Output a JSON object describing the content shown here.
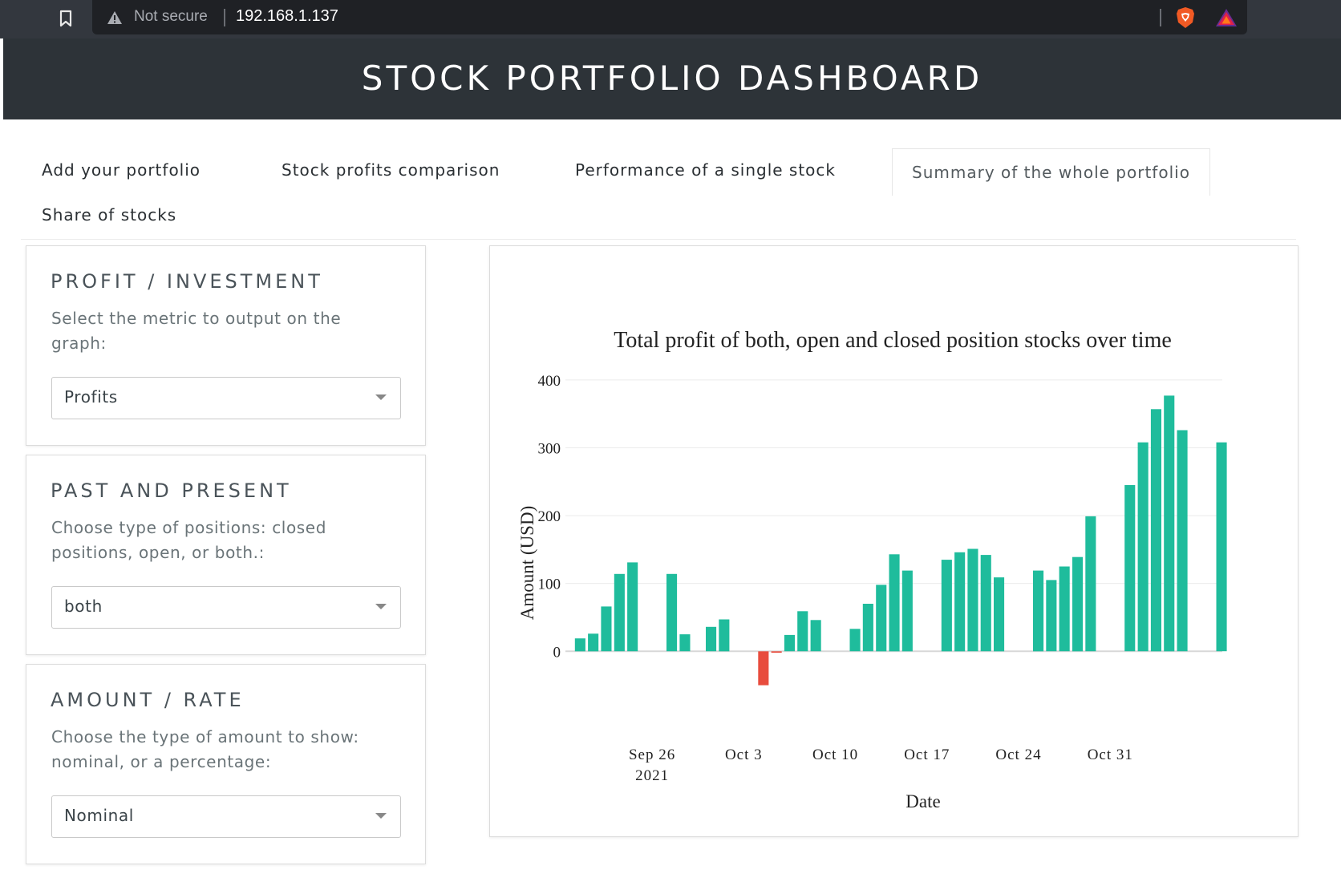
{
  "browser": {
    "security_label": "Not secure",
    "url": "192.168.1.137"
  },
  "header": {
    "title": "STOCK PORTFOLIO DASHBOARD"
  },
  "tabs": [
    {
      "label": "Add your portfolio",
      "active": false
    },
    {
      "label": "Stock profits comparison",
      "active": false
    },
    {
      "label": "Performance of a single stock",
      "active": false
    },
    {
      "label": "Summary of the whole portfolio",
      "active": true
    },
    {
      "label": "Share of stocks",
      "active": false
    }
  ],
  "controls": [
    {
      "title": "PROFIT / INVESTMENT",
      "description": "Select the metric to output on the graph:",
      "selected": "Profits"
    },
    {
      "title": "PAST AND PRESENT",
      "description": "Choose type of positions: closed positions, open, or both.:",
      "selected": "both"
    },
    {
      "title": "AMOUNT / RATE",
      "description": "Choose the type of amount to show: nominal, or a percentage:",
      "selected": "Nominal"
    }
  ],
  "colors": {
    "positive": "#1fbc9c",
    "negative": "#e84c3d",
    "header_bg": "#2d3338"
  },
  "chart_data": {
    "type": "bar",
    "title": "Total profit of both, open and closed position stocks over time",
    "xlabel": "Date",
    "ylabel": "Amount (USD)",
    "ylim": [
      -60,
      420
    ],
    "yticks": [
      0,
      100,
      200,
      300,
      400
    ],
    "x_tick_labels": [
      {
        "date": "2021-09-26",
        "label": "Sep 26",
        "sublabel": "2021"
      },
      {
        "date": "2021-10-03",
        "label": "Oct 3",
        "sublabel": ""
      },
      {
        "date": "2021-10-10",
        "label": "Oct 10",
        "sublabel": ""
      },
      {
        "date": "2021-10-17",
        "label": "Oct 17",
        "sublabel": ""
      },
      {
        "date": "2021-10-24",
        "label": "Oct 24",
        "sublabel": ""
      },
      {
        "date": "2021-10-31",
        "label": "Oct 31",
        "sublabel": ""
      }
    ],
    "grid": true,
    "legend": "none",
    "series": [
      {
        "points": [
          {
            "x": "2021-09-20",
            "y": 19
          },
          {
            "x": "2021-09-21",
            "y": 26
          },
          {
            "x": "2021-09-22",
            "y": 66
          },
          {
            "x": "2021-09-23",
            "y": 114
          },
          {
            "x": "2021-09-24",
            "y": 131
          },
          {
            "x": "2021-09-27",
            "y": 114
          },
          {
            "x": "2021-09-28",
            "y": 25
          },
          {
            "x": "2021-09-30",
            "y": 36
          },
          {
            "x": "2021-10-01",
            "y": 47
          },
          {
            "x": "2021-10-04",
            "y": -50
          },
          {
            "x": "2021-10-05",
            "y": -2
          },
          {
            "x": "2021-10-06",
            "y": 24
          },
          {
            "x": "2021-10-07",
            "y": 59
          },
          {
            "x": "2021-10-08",
            "y": 46
          },
          {
            "x": "2021-10-11",
            "y": 33
          },
          {
            "x": "2021-10-12",
            "y": 70
          },
          {
            "x": "2021-10-13",
            "y": 98
          },
          {
            "x": "2021-10-14",
            "y": 143
          },
          {
            "x": "2021-10-15",
            "y": 119
          },
          {
            "x": "2021-10-18",
            "y": 135
          },
          {
            "x": "2021-10-19",
            "y": 146
          },
          {
            "x": "2021-10-20",
            "y": 151
          },
          {
            "x": "2021-10-21",
            "y": 142
          },
          {
            "x": "2021-10-22",
            "y": 109
          },
          {
            "x": "2021-10-25",
            "y": 119
          },
          {
            "x": "2021-10-26",
            "y": 105
          },
          {
            "x": "2021-10-27",
            "y": 125
          },
          {
            "x": "2021-10-28",
            "y": 139
          },
          {
            "x": "2021-10-29",
            "y": 199
          },
          {
            "x": "2021-11-01",
            "y": 245
          },
          {
            "x": "2021-11-02",
            "y": 308
          },
          {
            "x": "2021-11-03",
            "y": 357
          },
          {
            "x": "2021-11-04",
            "y": 377
          },
          {
            "x": "2021-11-05",
            "y": 326
          },
          {
            "x": "2021-11-08",
            "y": 308
          }
        ]
      }
    ]
  }
}
